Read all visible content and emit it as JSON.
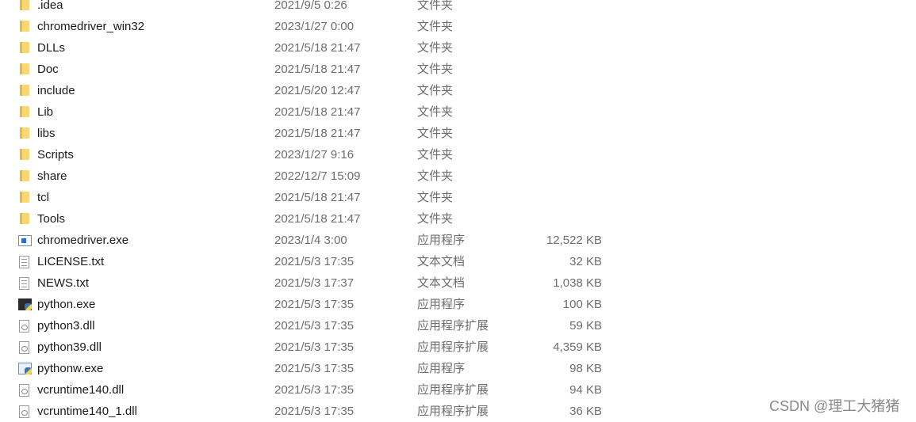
{
  "files": [
    {
      "name": ".idea",
      "date": "2021/9/5 0:26",
      "type": "文件夹",
      "size": "",
      "icon": "folder"
    },
    {
      "name": "chromedriver_win32",
      "date": "2023/1/27 0:00",
      "type": "文件夹",
      "size": "",
      "icon": "folder"
    },
    {
      "name": "DLLs",
      "date": "2021/5/18 21:47",
      "type": "文件夹",
      "size": "",
      "icon": "folder"
    },
    {
      "name": "Doc",
      "date": "2021/5/18 21:47",
      "type": "文件夹",
      "size": "",
      "icon": "folder"
    },
    {
      "name": "include",
      "date": "2021/5/20 12:47",
      "type": "文件夹",
      "size": "",
      "icon": "folder"
    },
    {
      "name": "Lib",
      "date": "2021/5/18 21:47",
      "type": "文件夹",
      "size": "",
      "icon": "folder"
    },
    {
      "name": "libs",
      "date": "2021/5/18 21:47",
      "type": "文件夹",
      "size": "",
      "icon": "folder"
    },
    {
      "name": "Scripts",
      "date": "2023/1/27 9:16",
      "type": "文件夹",
      "size": "",
      "icon": "folder"
    },
    {
      "name": "share",
      "date": "2022/12/7 15:09",
      "type": "文件夹",
      "size": "",
      "icon": "folder"
    },
    {
      "name": "tcl",
      "date": "2021/5/18 21:47",
      "type": "文件夹",
      "size": "",
      "icon": "folder"
    },
    {
      "name": "Tools",
      "date": "2021/5/18 21:47",
      "type": "文件夹",
      "size": "",
      "icon": "folder"
    },
    {
      "name": "chromedriver.exe",
      "date": "2023/1/4 3:00",
      "type": "应用程序",
      "size": "12,522 KB",
      "icon": "app"
    },
    {
      "name": "LICENSE.txt",
      "date": "2021/5/3 17:35",
      "type": "文本文档",
      "size": "32 KB",
      "icon": "txt"
    },
    {
      "name": "NEWS.txt",
      "date": "2021/5/3 17:37",
      "type": "文本文档",
      "size": "1,038 KB",
      "icon": "txt"
    },
    {
      "name": "python.exe",
      "date": "2021/5/3 17:35",
      "type": "应用程序",
      "size": "100 KB",
      "icon": "py"
    },
    {
      "name": "python3.dll",
      "date": "2021/5/3 17:35",
      "type": "应用程序扩展",
      "size": "59 KB",
      "icon": "dll"
    },
    {
      "name": "python39.dll",
      "date": "2021/5/3 17:35",
      "type": "应用程序扩展",
      "size": "4,359 KB",
      "icon": "dll"
    },
    {
      "name": "pythonw.exe",
      "date": "2021/5/3 17:35",
      "type": "应用程序",
      "size": "98 KB",
      "icon": "pyw"
    },
    {
      "name": "vcruntime140.dll",
      "date": "2021/5/3 17:35",
      "type": "应用程序扩展",
      "size": "94 KB",
      "icon": "dll"
    },
    {
      "name": "vcruntime140_1.dll",
      "date": "2021/5/3 17:35",
      "type": "应用程序扩展",
      "size": "36 KB",
      "icon": "dll"
    }
  ],
  "watermark": "CSDN @理工大猪猪"
}
